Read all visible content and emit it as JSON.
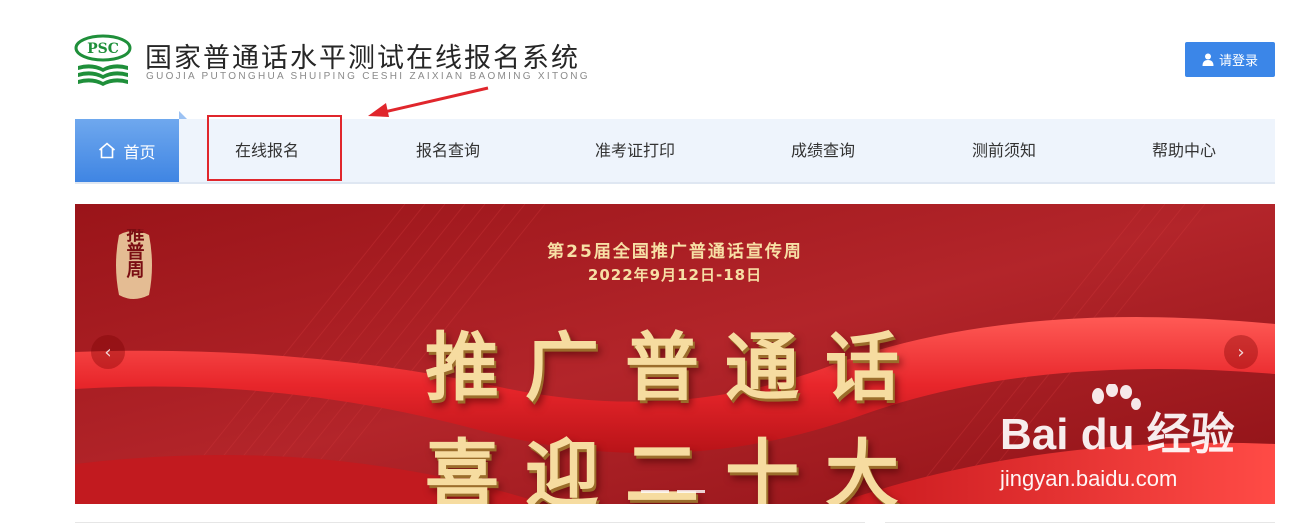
{
  "header": {
    "logo_text": "PSC",
    "title": "国家普通话水平测试在线报名系统",
    "subtitle": "GUOJIA PUTONGHUA SHUIPING CESHI ZAIXIAN BAOMING XITONG",
    "login_label": "请登录"
  },
  "nav": {
    "items": [
      {
        "label": "首页"
      },
      {
        "label": "在线报名"
      },
      {
        "label": "报名查询"
      },
      {
        "label": "准考证打印"
      },
      {
        "label": "成绩查询"
      },
      {
        "label": "测前须知"
      },
      {
        "label": "帮助中心"
      }
    ]
  },
  "banner": {
    "seal_text": "推普周",
    "event": "第25届全国推广普通话宣传周",
    "dates": "2022年9月12日-18日",
    "line1": "推广普通话",
    "line2": "喜迎二十大",
    "prev": "‹",
    "next": "›"
  },
  "watermark": {
    "brand": "Bai du 经验",
    "url": "jingyan.baidu.com"
  },
  "colors": {
    "accent": "#3b86e8",
    "banner_red": "#a51a1f",
    "highlight": "#e0262c",
    "gold": "#f6dca0",
    "logo_green": "#1f8f3a"
  },
  "icons": [
    "user-icon",
    "home-icon",
    "chevron-left-icon",
    "chevron-right-icon",
    "arrow-annotation-icon",
    "paw-icon"
  ]
}
